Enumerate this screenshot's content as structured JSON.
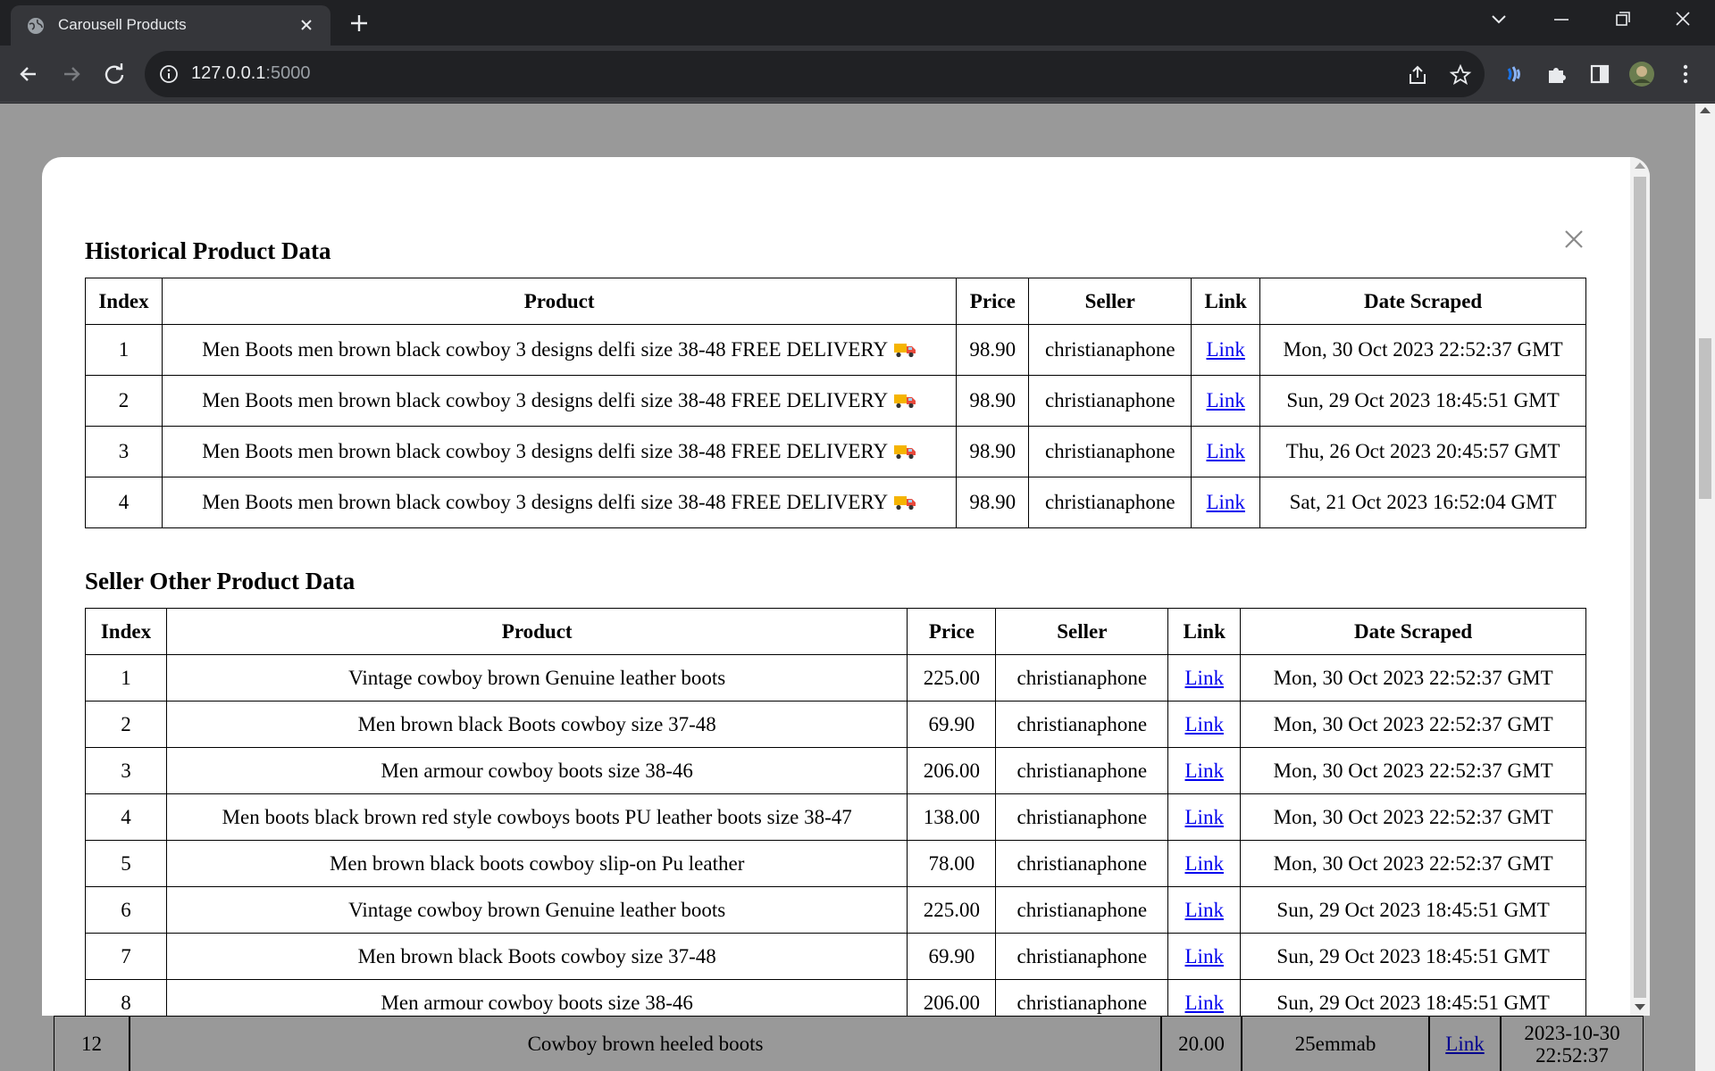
{
  "browser": {
    "tab_title": "Carousell Products",
    "url_host": "127.0.0.1",
    "url_port": ":5000"
  },
  "modal": {
    "historical": {
      "heading": "Historical Product Data",
      "columns": [
        "Index",
        "Product",
        "Price",
        "Seller",
        "Link",
        "Date Scraped"
      ],
      "rows": [
        {
          "index": "1",
          "product": "Men Boots men brown black cowboy 3 designs delfi size 38-48 FREE DELIVERY",
          "price": "98.90",
          "seller": "christianaphone",
          "link": "Link",
          "date": "Mon, 30 Oct 2023 22:52:37 GMT"
        },
        {
          "index": "2",
          "product": "Men Boots men brown black cowboy 3 designs delfi size 38-48 FREE DELIVERY",
          "price": "98.90",
          "seller": "christianaphone",
          "link": "Link",
          "date": "Sun, 29 Oct 2023 18:45:51 GMT"
        },
        {
          "index": "3",
          "product": "Men Boots men brown black cowboy 3 designs delfi size 38-48 FREE DELIVERY",
          "price": "98.90",
          "seller": "christianaphone",
          "link": "Link",
          "date": "Thu, 26 Oct 2023 20:45:57 GMT"
        },
        {
          "index": "4",
          "product": "Men Boots men brown black cowboy 3 designs delfi size 38-48 FREE DELIVERY",
          "price": "98.90",
          "seller": "christianaphone",
          "link": "Link",
          "date": "Sat, 21 Oct 2023 16:52:04 GMT"
        }
      ]
    },
    "seller_other": {
      "heading": "Seller Other Product Data",
      "columns": [
        "Index",
        "Product",
        "Price",
        "Seller",
        "Link",
        "Date Scraped"
      ],
      "rows": [
        {
          "index": "1",
          "product": "Vintage cowboy brown Genuine leather boots",
          "price": "225.00",
          "seller": "christianaphone",
          "link": "Link",
          "date": "Mon, 30 Oct 2023 22:52:37 GMT"
        },
        {
          "index": "2",
          "product": "Men brown black Boots cowboy size 37-48",
          "price": "69.90",
          "seller": "christianaphone",
          "link": "Link",
          "date": "Mon, 30 Oct 2023 22:52:37 GMT"
        },
        {
          "index": "3",
          "product": "Men armour cowboy boots size 38-46",
          "price": "206.00",
          "seller": "christianaphone",
          "link": "Link",
          "date": "Mon, 30 Oct 2023 22:52:37 GMT"
        },
        {
          "index": "4",
          "product": "Men boots black brown red style cowboys boots PU leather boots size 38-47",
          "price": "138.00",
          "seller": "christianaphone",
          "link": "Link",
          "date": "Mon, 30 Oct 2023 22:52:37 GMT"
        },
        {
          "index": "5",
          "product": "Men brown black boots cowboy slip-on Pu leather",
          "price": "78.00",
          "seller": "christianaphone",
          "link": "Link",
          "date": "Mon, 30 Oct 2023 22:52:37 GMT"
        },
        {
          "index": "6",
          "product": "Vintage cowboy brown Genuine leather boots",
          "price": "225.00",
          "seller": "christianaphone",
          "link": "Link",
          "date": "Sun, 29 Oct 2023 18:45:51 GMT"
        },
        {
          "index": "7",
          "product": "Men brown black Boots cowboy size 37-48",
          "price": "69.90",
          "seller": "christianaphone",
          "link": "Link",
          "date": "Sun, 29 Oct 2023 18:45:51 GMT"
        },
        {
          "index": "8",
          "product": "Men armour cowboy boots size 38-46",
          "price": "206.00",
          "seller": "christianaphone",
          "link": "Link",
          "date": "Sun, 29 Oct 2023 18:45:51 GMT"
        }
      ]
    }
  },
  "background_row": {
    "index": "12",
    "product": "Cowboy brown heeled boots",
    "price": "20.00",
    "seller": "25emmab",
    "link": "Link",
    "date_line1": "2023-10-30",
    "date_line2": "22:52:37"
  },
  "colors": {
    "link": "#0000ee",
    "chrome_dark": "#202124",
    "chrome_toolbar": "#35363a",
    "accent_blue": "#8ab4f8"
  }
}
